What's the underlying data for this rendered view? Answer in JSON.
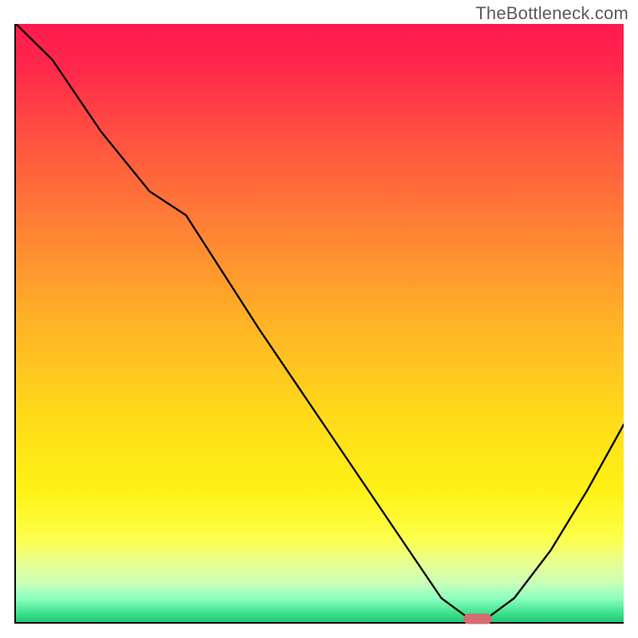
{
  "watermark": "TheBottleneck.com",
  "chart_data": {
    "type": "line",
    "title": "",
    "xlabel": "",
    "ylabel": "",
    "xlim": [
      0,
      100
    ],
    "ylim": [
      0,
      100
    ],
    "grid": false,
    "legend": false,
    "background_gradient_stops": [
      {
        "offset": 0.0,
        "color": "#ff1a4f"
      },
      {
        "offset": 0.08,
        "color": "#ff2a4a"
      },
      {
        "offset": 0.2,
        "color": "#ff5540"
      },
      {
        "offset": 0.35,
        "color": "#ff8434"
      },
      {
        "offset": 0.5,
        "color": "#ffb326"
      },
      {
        "offset": 0.65,
        "color": "#ffd91a"
      },
      {
        "offset": 0.78,
        "color": "#fff215"
      },
      {
        "offset": 0.86,
        "color": "#fcff4a"
      },
      {
        "offset": 0.9,
        "color": "#e9ff90"
      },
      {
        "offset": 0.935,
        "color": "#c8ffb8"
      },
      {
        "offset": 0.96,
        "color": "#8effc0"
      },
      {
        "offset": 0.985,
        "color": "#3fe28d"
      },
      {
        "offset": 1.0,
        "color": "#1ec971"
      }
    ],
    "series": [
      {
        "name": "bottleneck-curve",
        "x": [
          0,
          6,
          14,
          22,
          28,
          40,
          52,
          64,
          70,
          74,
          78,
          82,
          88,
          94,
          100
        ],
        "y": [
          100,
          94,
          82,
          72,
          68,
          49,
          31,
          13,
          4,
          1,
          1,
          4,
          12,
          22,
          33
        ]
      }
    ],
    "marker": {
      "x": 76,
      "y": 0.6,
      "color": "#d66b71"
    },
    "annotations": []
  }
}
